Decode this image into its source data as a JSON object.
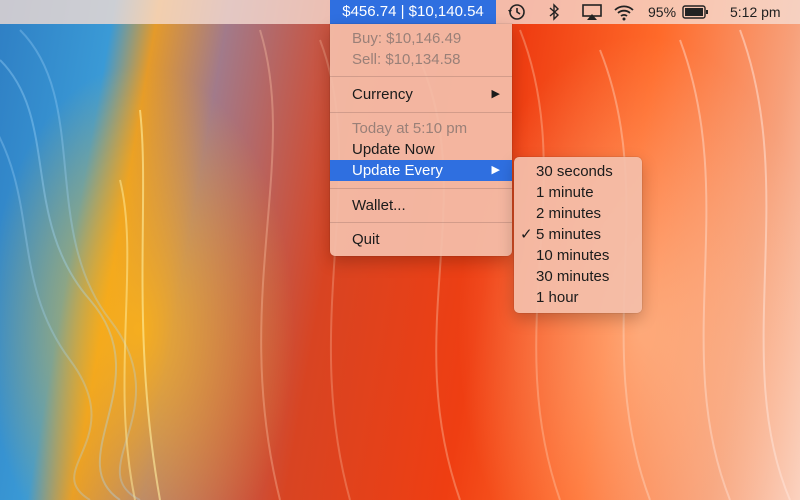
{
  "menubar": {
    "ticker": "$456.74 | $10,140.54",
    "battery_percent": "95%",
    "clock": "5:12 pm",
    "icons": [
      "history-icon",
      "bluetooth-icon",
      "airplay-icon",
      "wifi-icon",
      "battery-icon"
    ]
  },
  "main_menu": {
    "buy": "Buy: $10,146.49",
    "sell": "Sell: $10,134.58",
    "currency": "Currency",
    "updated": "Today at 5:10 pm",
    "update_now": "Update Now",
    "update_every": "Update Every",
    "wallet": "Wallet...",
    "quit": "Quit"
  },
  "interval_menu": {
    "options": [
      "30 seconds",
      "1 minute",
      "2 minutes",
      "5 minutes",
      "10 minutes",
      "30 minutes",
      "1 hour"
    ],
    "selected": "5 minutes",
    "check_glyph": "✓"
  },
  "colors": {
    "highlight": "#2f6fe0",
    "menu_bg": "#f4beaa"
  }
}
